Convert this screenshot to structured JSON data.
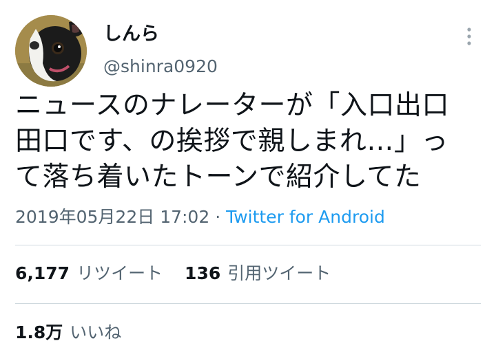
{
  "user": {
    "display_name": "しんら",
    "handle": "@shinra0920"
  },
  "tweet": {
    "text": "ニュースのナレーターが「入口出口\n田口です、の挨拶で親しまれ…」っ\nて落ち着いたトーンで紹介してた",
    "timestamp": "2019年05月22日 17:02",
    "separator": " · ",
    "source": "Twitter for Android"
  },
  "stats": {
    "retweets_count": "6,177",
    "retweets_label": "リツイート",
    "quotes_count": "136",
    "quotes_label": "引用ツイート",
    "likes_count": "1.8万",
    "likes_label": "いいね"
  },
  "colors": {
    "text": "#0f1419",
    "secondary": "#536471",
    "link": "#1d9bf0",
    "divider": "#cfd9de"
  },
  "icons": {
    "more": "more-vertical-icon",
    "avatar": "dog-avatar"
  }
}
